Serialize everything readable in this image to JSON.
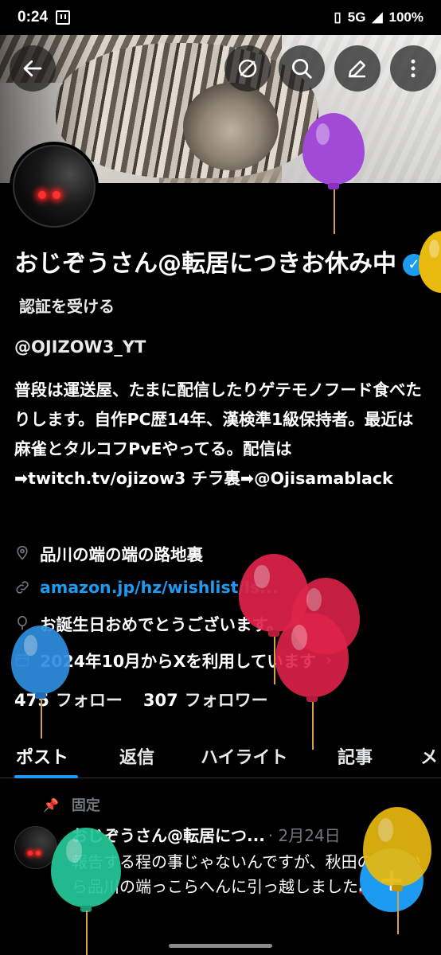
{
  "status_bar": {
    "time": "0:24",
    "network": "5G",
    "battery": "100%"
  },
  "header": {
    "back_label": "back",
    "buttons": [
      "grok-icon",
      "search-icon",
      "edit-icon",
      "more-icon"
    ]
  },
  "profile": {
    "name": "おじぞうさん@転居につきお休み中",
    "get_verified": "認証を受ける",
    "handle": "@OJIZOW3_YT",
    "bio": "普段は運送屋、たまに配信したりゲテモノフード食べたりします。自作PC歴14年、漢検準1級保持者。最近は麻雀とタルコフPvEやってる。配信は➡twitch.tv/ojizow3 チラ裏➡@Ojisamablack",
    "location": "品川の端の端の路地裏",
    "link": "amazon.jp/hz/wishlist/ls...",
    "birthday": "お誕生日おめでとうございます。",
    "joined": "2024年10月からXを利用しています",
    "following_count": "475",
    "following_label": "フォロー",
    "followers_count": "307",
    "followers_label": "フォロワー"
  },
  "tabs": [
    "ポスト",
    "返信",
    "ハイライト",
    "記事",
    "メ"
  ],
  "pinned_post": {
    "pinned_label": "固定",
    "author": "おじぞうさん@転居につ...",
    "date": "· 2月24日",
    "text": "報告する程の事じゃないんですが、秋田の辺境から品川の端っこらへんに引っ越しました🚚📦🧾"
  },
  "colors": {
    "accent": "#1d9bf0",
    "background": "#000000",
    "text": "#e7e9ea",
    "muted": "#71767b"
  }
}
